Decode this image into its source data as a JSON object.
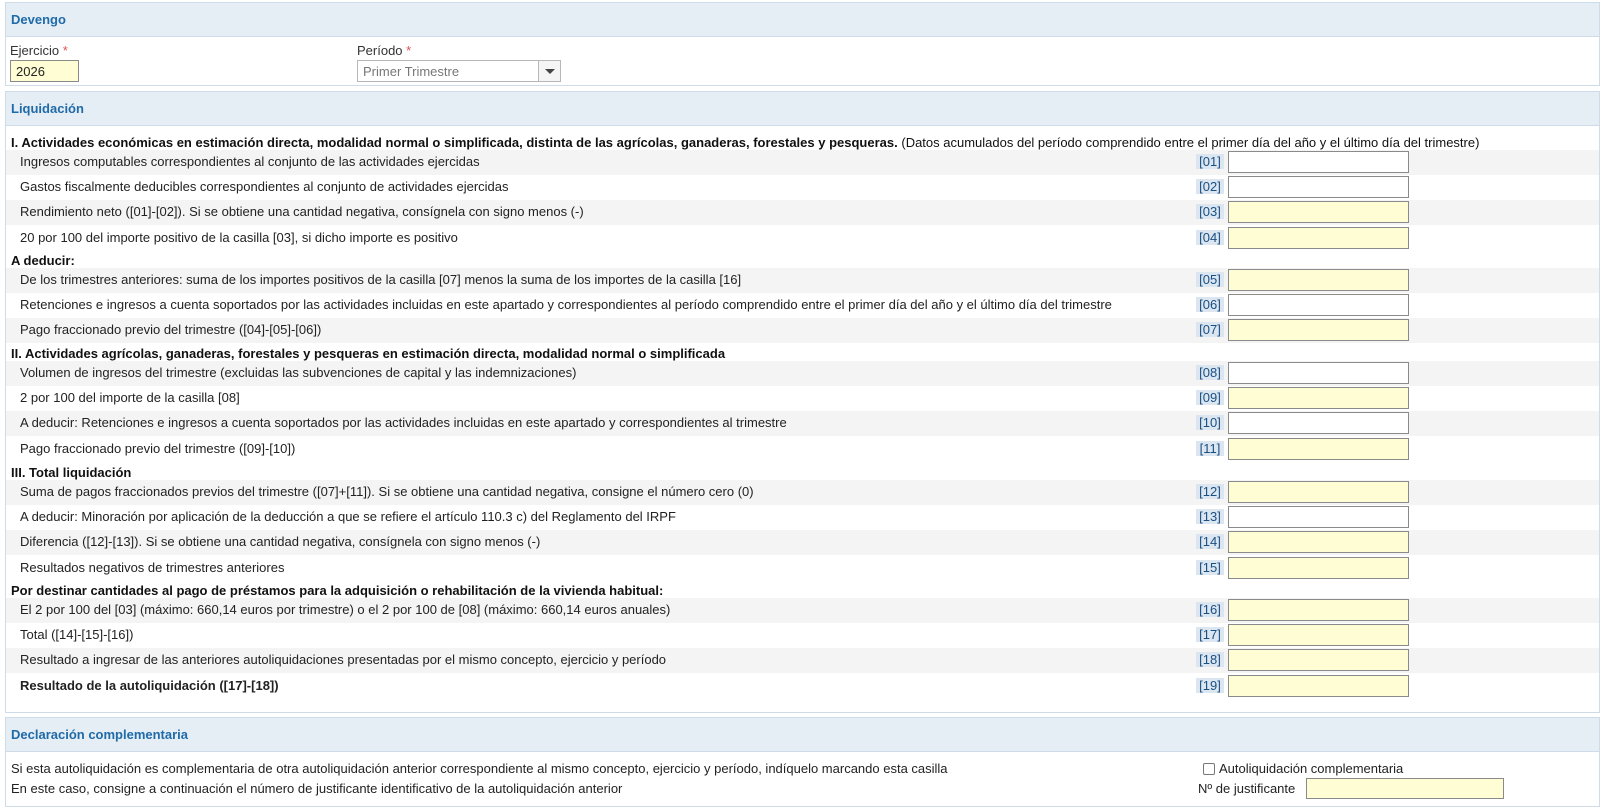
{
  "devengo": {
    "title": "Devengo",
    "ejercicio_label": "Ejercicio",
    "ejercicio_value": "2026",
    "periodo_label": "Período",
    "periodo_value": "Primer Trimestre",
    "required_mark": "*"
  },
  "liquidacion": {
    "title": "Liquidación",
    "section1_title": "I. Actividades económicas en estimación directa, modalidad normal o simplificada, distinta de las agrícolas, ganaderas, forestales y pesqueras.",
    "section1_note": "(Datos acumulados del período comprendido entre el primer día del año y el último día del trimestre)",
    "rows1": [
      {
        "text": "Ingresos computables correspondientes al conjunto de las actividades ejercidas",
        "code": "[01]"
      },
      {
        "text": "Gastos fiscalmente deducibles correspondientes al conjunto de actividades ejercidas",
        "code": "[02]"
      },
      {
        "text": "Rendimiento neto ([01]-[02]). Si se obtiene una cantidad negativa, consígnela con signo menos (-)",
        "code": "[03]"
      },
      {
        "text": "20 por 100 del importe positivo de la casilla [03], si dicho importe es positivo",
        "code": "[04]"
      }
    ],
    "deducir_title": "A deducir:",
    "rows2": [
      {
        "text": "De los trimestres anteriores: suma de los importes positivos de la casilla [07] menos la suma de los importes de la casilla [16]",
        "code": "[05]"
      },
      {
        "text": "Retenciones e ingresos a cuenta soportados por las actividades incluidas en este apartado y correspondientes al período comprendido entre el primer día del año y el último día del trimestre",
        "code": "[06]"
      },
      {
        "text": "Pago fraccionado previo del trimestre ([04]-[05]-[06])",
        "code": "[07]"
      }
    ],
    "section2_title": "II. Actividades agrícolas, ganaderas, forestales y pesqueras en estimación directa, modalidad normal o simplificada",
    "rows3": [
      {
        "text": "Volumen de ingresos del trimestre (excluidas las subvenciones de capital y las indemnizaciones)",
        "code": "[08]"
      },
      {
        "text": "2 por 100 del importe de la casilla [08]",
        "code": "[09]"
      },
      {
        "text": "A deducir: Retenciones e ingresos a cuenta soportados por las actividades incluidas en este apartado y correspondientes al trimestre",
        "code": "[10]"
      },
      {
        "text": "Pago fraccionado previo del trimestre ([09]-[10])",
        "code": "[11]"
      }
    ],
    "section3_title": "III. Total liquidación",
    "rows4": [
      {
        "text": "Suma de pagos fraccionados previos del trimestre ([07]+[11]). Si se obtiene una cantidad negativa, consigne el número cero (0)",
        "code": "[12]"
      },
      {
        "text": "A deducir: Minoración por aplicación de la deducción a que se refiere el artículo 110.3 c) del Reglamento del IRPF",
        "code": "[13]"
      },
      {
        "text": "Diferencia ([12]-[13]). Si se obtiene una cantidad negativa, consígnela con signo menos (-)",
        "code": "[14]"
      },
      {
        "text": "Resultados negativos de trimestres anteriores",
        "code": "[15]"
      }
    ],
    "section4_title": "Por destinar cantidades al pago de préstamos para la adquisición o rehabilitación de la vivienda habitual:",
    "rows5": [
      {
        "text": "El 2 por 100 del [03] (máximo: 660,14 euros por trimestre) o el 2 por 100 de [08] (máximo: 660,14 euros anuales)",
        "code": "[16]"
      },
      {
        "text": "Total ([14]-[15]-[16])",
        "code": "[17]"
      },
      {
        "text": "Resultado a ingresar de las anteriores autoliquidaciones presentadas por el mismo concepto, ejercicio y período",
        "code": "[18]"
      },
      {
        "text": "Resultado de la autoliquidación ([17]-[18])",
        "code": "[19]"
      }
    ]
  },
  "complementaria": {
    "title": "Declaración complementaria",
    "line1": "Si esta autoliquidación es complementaria de otra autoliquidación anterior correspondiente al mismo concepto, ejercicio y período, indíquelo marcando esta casilla",
    "checkbox_label": "Autoliquidación complementaria",
    "line2": "En este caso, consigne a continuación el número de justificante identificativo de la autoliquidación anterior",
    "justificante_label": "Nº de justificante"
  }
}
